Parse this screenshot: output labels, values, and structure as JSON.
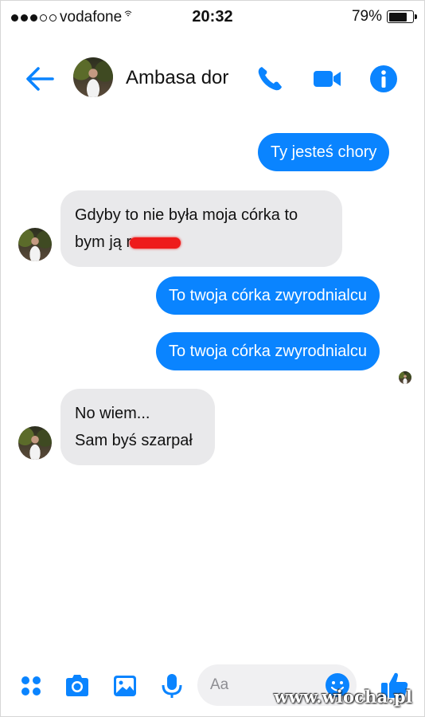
{
  "status_bar": {
    "carrier": "vodafone",
    "time": "20:32",
    "battery": "79%",
    "battery_level": 0.79
  },
  "header": {
    "contact_name": "Ambasa dor",
    "icons": [
      "back-arrow-icon",
      "phone-icon",
      "video-camera-icon",
      "info-icon"
    ]
  },
  "messages": [
    {
      "from": "me",
      "lines": [
        "Ty jesteś chory"
      ]
    },
    {
      "from": "contact",
      "lines": [
        "Gdyby to nie była moja córka to",
        "bym ją r"
      ]
    },
    {
      "from": "me",
      "lines": [
        "To twoja córka zwyrodnialcu"
      ]
    },
    {
      "from": "me",
      "lines": [
        "To twoja córka zwyrodnialcu"
      ]
    },
    {
      "from": "contact",
      "lines": [
        "No wiem...",
        "Sam byś szarpał"
      ]
    }
  ],
  "composer": {
    "placeholder": "Aa",
    "icons": [
      "menu-dots-icon",
      "camera-icon",
      "gallery-icon",
      "microphone-icon",
      "emoji-icon",
      "like-icon"
    ]
  },
  "watermark": "www.wiocha.pl",
  "colors": {
    "accent": "#0a84ff",
    "incoming_bubble": "#e9e9eb",
    "redaction": "#ee1b1b"
  }
}
